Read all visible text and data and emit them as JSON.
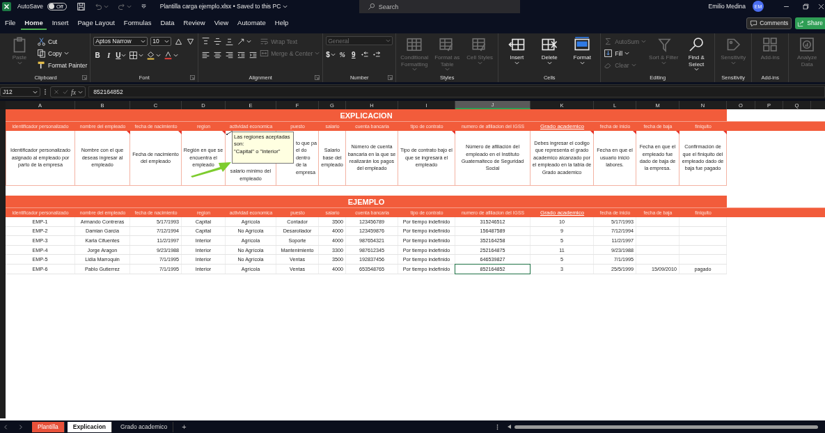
{
  "title_bar": {
    "autosave": {
      "label": "AutoSave",
      "on": false,
      "state_label": "Off"
    },
    "file_title": "Plantilla carga ejemplo.xlsx • Saved to this PC",
    "search": {
      "placeholder": "Search"
    },
    "user": {
      "name": "Emilio Medina",
      "initials": "EM"
    }
  },
  "menu": {
    "tabs": [
      {
        "label": "File",
        "selected": false
      },
      {
        "label": "Home",
        "selected": true
      },
      {
        "label": "Insert",
        "selected": false
      },
      {
        "label": "Page Layout",
        "selected": false
      },
      {
        "label": "Formulas",
        "selected": false
      },
      {
        "label": "Data",
        "selected": false
      },
      {
        "label": "Review",
        "selected": false
      },
      {
        "label": "View",
        "selected": false
      },
      {
        "label": "Automate",
        "selected": false
      },
      {
        "label": "Help",
        "selected": false
      }
    ],
    "comments_button": "Comments",
    "share_button": "Share"
  },
  "ribbon": {
    "groups": [
      {
        "label": "Clipboard",
        "launcher": true,
        "parts": [
          {
            "kind": "large",
            "label": "Paste",
            "disabled": true,
            "caret": true
          },
          {
            "kind": "stack",
            "items": [
              {
                "label": "Cut",
                "disabled": false,
                "caret": false
              },
              {
                "label": "Copy",
                "disabled": false,
                "caret": true
              },
              {
                "label": "Format Painter",
                "disabled": false,
                "caret": false
              }
            ]
          }
        ]
      },
      {
        "label": "Font",
        "launcher": true,
        "parts": [
          {
            "kind": "rows",
            "rows": [
              {
                "controls": [
                  {
                    "kind": "select",
                    "value": "Aptos Narrow",
                    "disabled": false
                  },
                  {
                    "kind": "select",
                    "value": "10",
                    "disabled": false
                  },
                  {
                    "kind": "icon",
                    "caret": false,
                    "disabled": false
                  },
                  {
                    "kind": "icon",
                    "caret": false,
                    "disabled": false
                  }
                ]
              },
              {
                "controls": [
                  {
                    "kind": "glyph",
                    "label": "B",
                    "caret": false,
                    "disabled": false
                  },
                  {
                    "kind": "glyph",
                    "label": "I",
                    "caret": false,
                    "disabled": false
                  },
                  {
                    "kind": "glyph",
                    "label": "U",
                    "caret": true,
                    "disabled": false
                  },
                  {
                    "kind": "icon",
                    "caret": true,
                    "disabled": false
                  },
                  {
                    "kind": "icon",
                    "caret": true,
                    "disabled": false
                  },
                  {
                    "kind": "icon",
                    "caret": true,
                    "disabled": false
                  }
                ]
              }
            ]
          }
        ]
      },
      {
        "label": "Alignment",
        "launcher": true,
        "parts": [
          {
            "kind": "rows",
            "rows": [
              {
                "controls": [
                  {
                    "kind": "icon",
                    "caret": false,
                    "disabled": false
                  },
                  {
                    "kind": "icon",
                    "caret": false,
                    "disabled": false
                  },
                  {
                    "kind": "icon",
                    "caret": false,
                    "disabled": false
                  },
                  {
                    "kind": "icon",
                    "caret": true,
                    "disabled": false
                  }
                ]
              },
              {
                "controls": [
                  {
                    "kind": "icon",
                    "caret": false,
                    "disabled": false
                  },
                  {
                    "kind": "icon",
                    "caret": false,
                    "disabled": false
                  },
                  {
                    "kind": "icon",
                    "caret": false,
                    "disabled": false
                  },
                  {
                    "kind": "icon",
                    "caret": false,
                    "disabled": false
                  },
                  {
                    "kind": "icon",
                    "caret": false,
                    "disabled": false
                  }
                ]
              }
            ]
          },
          {
            "kind": "stack",
            "items": [
              {
                "label": "Wrap Text",
                "disabled": true,
                "caret": false
              },
              {
                "label": "Merge & Center",
                "disabled": true,
                "caret": true
              }
            ]
          }
        ]
      },
      {
        "label": "Number",
        "launcher": true,
        "parts": [
          {
            "kind": "rows",
            "rows": [
              {
                "controls": [
                  {
                    "kind": "select",
                    "value": "General",
                    "disabled": true
                  }
                ]
              },
              {
                "controls": [
                  {
                    "kind": "glyph",
                    "label": "$",
                    "caret": true,
                    "disabled": false
                  },
                  {
                    "kind": "glyph",
                    "label": "%",
                    "caret": false,
                    "disabled": false
                  },
                  {
                    "kind": "glyph",
                    "label": "9",
                    "caret": false,
                    "disabled": false
                  },
                  {
                    "kind": "icon",
                    "caret": false,
                    "disabled": false
                  },
                  {
                    "kind": "icon",
                    "caret": false,
                    "disabled": false
                  }
                ]
              }
            ]
          }
        ]
      },
      {
        "label": "Styles",
        "parts": [
          {
            "kind": "large",
            "label": "Conditional Formatting",
            "disabled": true,
            "caret": true
          },
          {
            "kind": "large",
            "label": "Format as Table",
            "disabled": true,
            "caret": true
          },
          {
            "kind": "large",
            "label": "Cell Styles",
            "disabled": true,
            "caret": true
          }
        ]
      },
      {
        "label": "Cells",
        "parts": [
          {
            "kind": "large",
            "label": "Insert",
            "disabled": false,
            "caret": true
          },
          {
            "kind": "large",
            "label": "Delete",
            "disabled": false,
            "caret": true
          },
          {
            "kind": "large",
            "label": "Format",
            "disabled": false,
            "caret": true
          }
        ]
      },
      {
        "label": "Editing",
        "parts": [
          {
            "kind": "stack",
            "items": [
              {
                "label": "AutoSum",
                "disabled": true,
                "caret": true
              },
              {
                "label": "Fill",
                "disabled": false,
                "caret": true
              },
              {
                "label": "Clear",
                "disabled": true,
                "caret": true
              }
            ]
          },
          {
            "kind": "large",
            "label": "Sort & Filter",
            "disabled": true,
            "caret": true
          },
          {
            "kind": "large",
            "label": "Find & Select",
            "disabled": false,
            "caret": true
          }
        ]
      },
      {
        "label": "Sensitivity",
        "parts": [
          {
            "kind": "large",
            "label": "Sensitivity",
            "disabled": true,
            "caret": true
          }
        ]
      },
      {
        "label": "Add-ins",
        "parts": [
          {
            "kind": "large",
            "label": "Add-ins",
            "disabled": true,
            "caret": false
          }
        ]
      },
      {
        "parts": [
          {
            "kind": "large",
            "label": "Analyze Data",
            "disabled": true,
            "caret": false
          }
        ]
      }
    ]
  },
  "formula_bar": {
    "name_box": "J12",
    "function_label": "fx",
    "value": "852164852"
  },
  "column_headers": [
    {
      "label": "A",
      "selected": false
    },
    {
      "label": "B",
      "selected": false
    },
    {
      "label": "C",
      "selected": false
    },
    {
      "label": "D",
      "selected": false
    },
    {
      "label": "E",
      "selected": false
    },
    {
      "label": "F",
      "selected": false
    },
    {
      "label": "G",
      "selected": false
    },
    {
      "label": "H",
      "selected": false
    },
    {
      "label": "I",
      "selected": false
    },
    {
      "label": "J",
      "selected": true
    },
    {
      "label": "K",
      "selected": false
    },
    {
      "label": "L",
      "selected": false
    },
    {
      "label": "M",
      "selected": false
    },
    {
      "label": "N",
      "selected": false
    },
    {
      "label": "O",
      "selected": false
    },
    {
      "label": "P",
      "selected": false
    },
    {
      "label": "Q",
      "selected": false
    }
  ],
  "explicacion": {
    "title": "EXPLICACION",
    "columns": [
      {
        "label": "identificador personalizado",
        "link": false,
        "text": "Identificador personalizado asignado al empleado por parto de la empresa"
      },
      {
        "label": "nombre del empleado",
        "link": false,
        "comment": true,
        "text": "Nombre con el que deseas ingresar al empleado"
      },
      {
        "label": "fecha de nacimiento",
        "link": false,
        "comment": true,
        "text": "Fecha de nacimiento del empleado"
      },
      {
        "label": "region",
        "link": false,
        "comment": true,
        "text": "Región en que se encuentra el empleado"
      },
      {
        "label": "actividad economica",
        "link": false,
        "text": "salario mínimo del empleado"
      },
      {
        "label": "puesto",
        "link": false,
        "text": "to que pa el do dentro de la empresa"
      },
      {
        "label": "salario",
        "link": false,
        "text": "Salario base del empleado"
      },
      {
        "label": "cuenta bancaria",
        "link": false,
        "text": "Número de cuenta bancaria en la que se realizarán los pagos del empleado"
      },
      {
        "label": "tipo de contrato",
        "link": false,
        "comment": true,
        "text": "Tipo de contrato bajo el que se ingresará el empleado"
      },
      {
        "label": "numero de afiliacion del IGSS",
        "link": false,
        "text": "Número de afiliación del empleado en el Instituto Guatemalteco de Seguridad Social"
      },
      {
        "label": "Grado academico",
        "link": true,
        "comment": true,
        "text": "Debes ingresar el codigo que representa el grado academico alcanzado por el empleado en la tabla de Grado academico"
      },
      {
        "label": "fecha de inicio",
        "link": false,
        "comment": true,
        "text": "Fecha en que el usuario inició labores."
      },
      {
        "label": "fecha de baja",
        "link": false,
        "comment": true,
        "text": "Fecha en que el empleado fue dado de baja de la empresa."
      },
      {
        "label": "finiquito",
        "link": false,
        "comment": true,
        "text": "Confirmación de que el finiquito del empleado dado de baja fue pagado"
      }
    ]
  },
  "comment_popup": {
    "text": "Las regiones aceptadas son:\n\"Capital\" o \"Interior\""
  },
  "ejemplo": {
    "title": "EJEMPLO",
    "columns": [
      {
        "label": "identificador personalizado",
        "link": false
      },
      {
        "label": "nombre del empleado",
        "link": false
      },
      {
        "label": "fecha de nacimiento",
        "link": false
      },
      {
        "label": "region",
        "link": false
      },
      {
        "label": "actividad economica",
        "link": false
      },
      {
        "label": "puesto",
        "link": false
      },
      {
        "label": "salario",
        "link": false
      },
      {
        "label": "cuenta bancaria",
        "link": false
      },
      {
        "label": "tipo de contrato",
        "link": false
      },
      {
        "label": "numero de afiliacion del IGSS",
        "link": false
      },
      {
        "label": "Grado academico",
        "link": true
      },
      {
        "label": "fecha de inicio",
        "link": false
      },
      {
        "label": "fecha de baja",
        "link": false
      },
      {
        "label": "finiquito",
        "link": false
      }
    ],
    "rows": [
      {
        "selected": false,
        "cells": [
          "EMP-1",
          "Armando Contreras",
          "5/17/1993",
          "Capital",
          "Agrícola",
          "Contador",
          "3500",
          "123456789",
          "Por tiempo indefinido",
          "315246512",
          "10",
          "5/17/1993",
          null,
          null
        ]
      },
      {
        "selected": false,
        "cells": [
          "EMP-2",
          "Damian Garcia",
          "7/12/1994",
          "Capital",
          "No Agrícola",
          "Desarollador",
          "4000",
          "123459876",
          "Por tiempo indefinido",
          "156487589",
          "9",
          "7/12/1994",
          null,
          null
        ]
      },
      {
        "selected": false,
        "cells": [
          "EMP-3",
          "Karla Cifuentes",
          "11/2/1997",
          "Interior",
          "Agrícola",
          "Soporte",
          "4000",
          "987654321",
          "Por tiempo indefinido",
          "352164258",
          "5",
          "11/2/1997",
          null,
          null
        ]
      },
      {
        "selected": false,
        "cells": [
          "EMP-4",
          "Jorge Aragon",
          "9/23/1988",
          "Interior",
          "No Agrícola",
          "Mantenimiento",
          "3300",
          "987612345",
          "Por tiempo indefinido",
          "252164875",
          "11",
          "9/23/1988",
          null,
          null
        ]
      },
      {
        "selected": false,
        "cells": [
          "EMP-5",
          "Lidia Marroquin",
          "7/1/1995",
          "Interior",
          "No Agrícola",
          "Ventas",
          "3500",
          "192837456",
          "Por tiempo indefinido",
          "646539827",
          "5",
          "7/1/1995",
          null,
          null
        ]
      },
      {
        "selected": true,
        "cells": [
          "EMP-6",
          "Pablo Gutierrez",
          "7/1/1995",
          "Interior",
          "Agrícola",
          "Ventas",
          "4000",
          "653548765",
          "Por tiempo indefinido",
          "852164852",
          "3",
          "25/5/1999",
          "15/09/2010",
          "pagado"
        ]
      }
    ]
  },
  "sheet_tabs": {
    "tabs": [
      {
        "label": "Plantilla",
        "selected": false,
        "color": "#e8513a"
      },
      {
        "label": "Explicacion",
        "selected": true
      },
      {
        "label": "Grado academico",
        "selected": false
      }
    ],
    "add_label": "+"
  }
}
